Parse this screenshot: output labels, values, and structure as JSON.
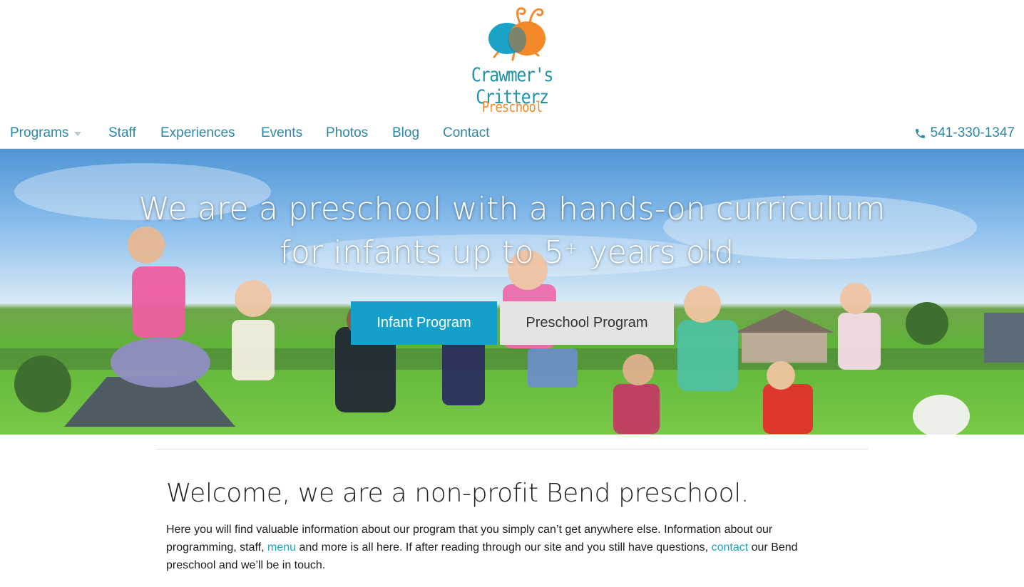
{
  "brand": {
    "name": "Crawmer's Critterz",
    "subtitle": "Preschool",
    "colors": {
      "teal": "#1f92a8",
      "orange": "#f4892a",
      "blue": "#1aa3c6"
    }
  },
  "nav": {
    "items": [
      {
        "label": "Programs",
        "has_dropdown": true
      },
      {
        "label": "Staff"
      },
      {
        "label": "Experiences"
      },
      {
        "label": "Events"
      },
      {
        "label": "Photos"
      },
      {
        "label": "Blog"
      },
      {
        "label": "Contact"
      }
    ],
    "phone": "541-330-1347",
    "phone_icon": "phone-icon"
  },
  "hero": {
    "line1": "We are a preschool with a hands-on curriculum",
    "line2_pre": "for infants up to 5",
    "line2_sup": "+",
    "line2_post": " years old.",
    "buttons": [
      {
        "label": "Infant Program",
        "color": "#14a0cb"
      },
      {
        "label": "Preschool Program",
        "color": "#e4e4e4"
      }
    ]
  },
  "main": {
    "heading": "Welcome, we are a non-profit Bend preschool.",
    "para_1": "Here you will find valuable information about our program that you simply can’t get anywhere else.  Information about our programming, staff, ",
    "link_menu": "menu",
    "para_2": " and more is all here.  If after reading through our site and you still have questions, ",
    "link_contact": "contact",
    "para_3": " our Bend preschool and we’ll be in touch."
  }
}
